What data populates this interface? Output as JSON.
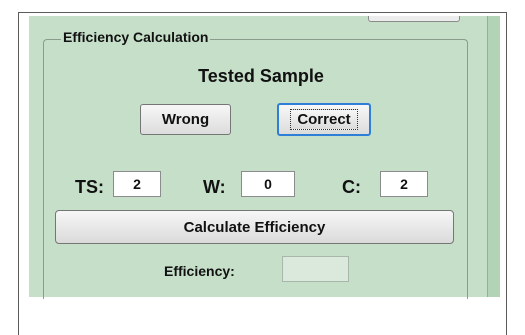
{
  "group": {
    "legend": "Efficiency Calculation"
  },
  "sample": {
    "title": "Tested Sample"
  },
  "buttons": {
    "wrong": "Wrong",
    "correct": "Correct",
    "calculate": "Calculate Efficiency"
  },
  "counts": {
    "ts_label": "TS:",
    "ts_value": "2",
    "w_label": "W:",
    "w_value": "0",
    "c_label": "C:",
    "c_value": "2"
  },
  "efficiency": {
    "label": "Efficiency:",
    "value": ""
  }
}
